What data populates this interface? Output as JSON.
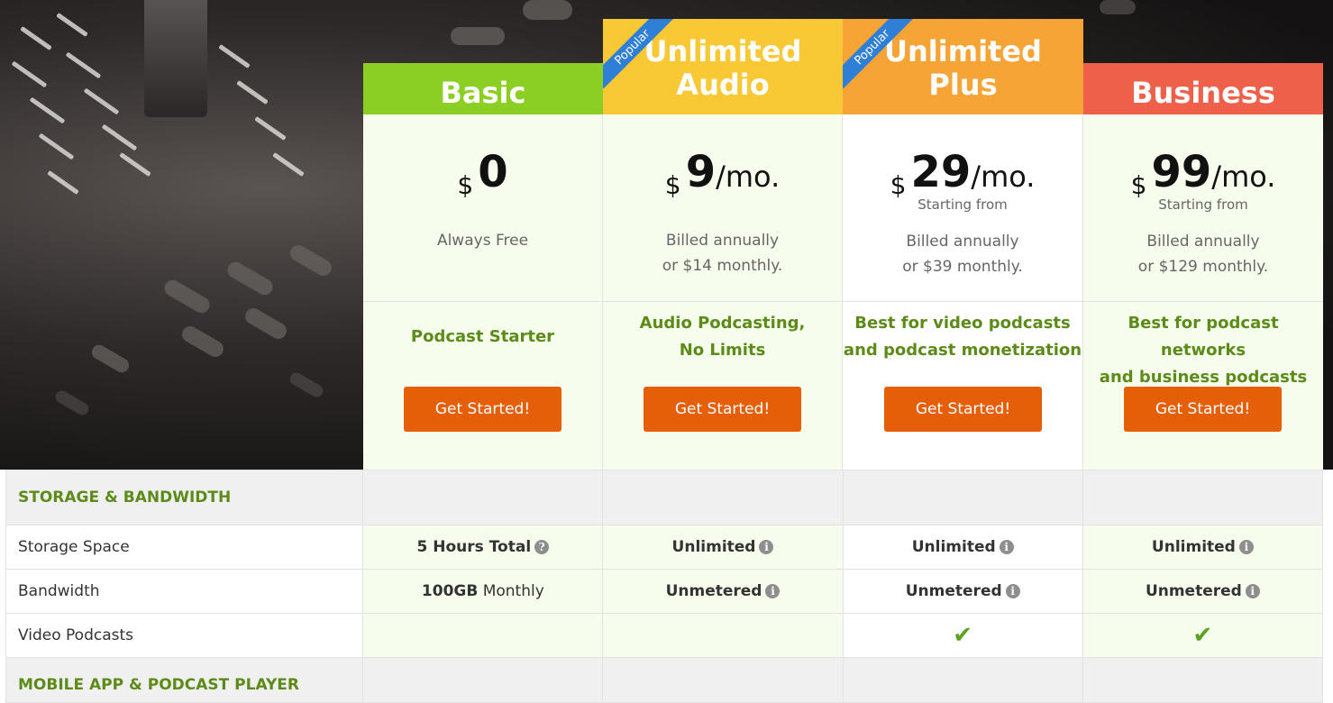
{
  "plans": [
    {
      "name_line1": "Basic",
      "name_line2": "",
      "popular": false,
      "currency": "$",
      "amount": "0",
      "per": "",
      "starting_from": "",
      "billing_line1": "Always Free",
      "billing_line2": "",
      "tagline_line1": "Podcast Starter",
      "tagline_line2": "",
      "button": "Get Started!",
      "header_color": "#8ccf24"
    },
    {
      "name_line1": "Unlimited",
      "name_line2": "Audio",
      "popular": true,
      "currency": "$",
      "amount": "9",
      "per": "/mo.",
      "starting_from": "",
      "billing_line1": "Billed annually",
      "billing_line2": "or $14 monthly.",
      "tagline_line1": "Audio Podcasting,",
      "tagline_line2": "No Limits",
      "button": "Get Started!",
      "header_color": "#f8c835"
    },
    {
      "name_line1": "Unlimited",
      "name_line2": "Plus",
      "popular": true,
      "currency": "$",
      "amount": "29",
      "per": "/mo.",
      "starting_from": "Starting from",
      "billing_line1": "Billed annually",
      "billing_line2": "or $39 monthly.",
      "tagline_line1": "Best for video podcasts",
      "tagline_line2": "and podcast monetization",
      "button": "Get Started!",
      "header_color": "#f7a436"
    },
    {
      "name_line1": "Business",
      "name_line2": "",
      "popular": false,
      "currency": "$",
      "amount": "99",
      "per": "/mo.",
      "starting_from": "Starting from",
      "billing_line1": "Billed annually",
      "billing_line2": "or $129 monthly.",
      "tagline_line1": "Best for podcast networks",
      "tagline_line2": "and business podcasts",
      "button": "Get Started!",
      "header_color": "#ef604a"
    }
  ],
  "popular_label": "Popular",
  "sections": {
    "storage": "STORAGE & BANDWIDTH",
    "mobile": "MOBILE APP & PODCAST PLAYER"
  },
  "rows": {
    "storage": {
      "label": "Storage Space",
      "basic_bold": "5 Hours Total",
      "audio": "Unlimited",
      "plus": "Unlimited",
      "business": "Unlimited"
    },
    "bandwidth": {
      "label": "Bandwidth",
      "basic_bold": "100GB",
      "basic_rest": "Monthly",
      "audio": "Unmetered",
      "plus": "Unmetered",
      "business": "Unmetered"
    },
    "video": {
      "label": "Video Podcasts",
      "basic": "",
      "audio": "",
      "plus": "✔",
      "business": "✔"
    }
  },
  "colors": {
    "button": "#e55e08",
    "accent_green": "#5d8b1a",
    "card_bg": "#f6fdec",
    "ribbon": "#2f7fd6"
  }
}
